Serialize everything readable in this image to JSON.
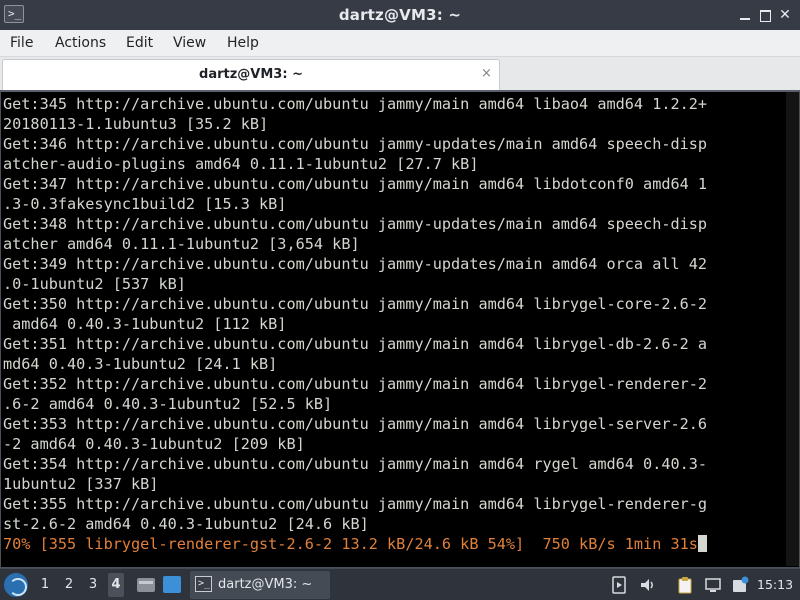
{
  "window": {
    "title": "dartz@VM3: ~",
    "icon": "terminal-icon"
  },
  "menubar": {
    "items": [
      "File",
      "Actions",
      "Edit",
      "View",
      "Help"
    ]
  },
  "tabs": [
    {
      "label": "dartz@VM3: ~",
      "close_glyph": "×"
    }
  ],
  "terminal": {
    "lines": [
      "Get:345 http://archive.ubuntu.com/ubuntu jammy/main amd64 libao4 amd64 1.2.2+",
      "20180113-1.1ubuntu3 [35.2 kB]",
      "Get:346 http://archive.ubuntu.com/ubuntu jammy-updates/main amd64 speech-disp",
      "atcher-audio-plugins amd64 0.11.1-1ubuntu2 [27.7 kB]",
      "Get:347 http://archive.ubuntu.com/ubuntu jammy/main amd64 libdotconf0 amd64 1",
      ".3-0.3fakesync1build2 [15.3 kB]",
      "Get:348 http://archive.ubuntu.com/ubuntu jammy-updates/main amd64 speech-disp",
      "atcher amd64 0.11.1-1ubuntu2 [3,654 kB]",
      "Get:349 http://archive.ubuntu.com/ubuntu jammy-updates/main amd64 orca all 42",
      ".0-1ubuntu2 [537 kB]",
      "Get:350 http://archive.ubuntu.com/ubuntu jammy/main amd64 librygel-core-2.6-2",
      " amd64 0.40.3-1ubuntu2 [112 kB]",
      "Get:351 http://archive.ubuntu.com/ubuntu jammy/main amd64 librygel-db-2.6-2 a",
      "md64 0.40.3-1ubuntu2 [24.1 kB]",
      "Get:352 http://archive.ubuntu.com/ubuntu jammy/main amd64 librygel-renderer-2",
      ".6-2 amd64 0.40.3-1ubuntu2 [52.5 kB]",
      "Get:353 http://archive.ubuntu.com/ubuntu jammy/main amd64 librygel-server-2.6",
      "-2 amd64 0.40.3-1ubuntu2 [209 kB]",
      "Get:354 http://archive.ubuntu.com/ubuntu jammy/main amd64 rygel amd64 0.40.3-",
      "1ubuntu2 [337 kB]",
      "Get:355 http://archive.ubuntu.com/ubuntu jammy/main amd64 librygel-renderer-g",
      "st-2.6-2 amd64 0.40.3-1ubuntu2 [24.6 kB]"
    ],
    "progress_line": "70% [355 librygel-renderer-gst-2.6-2 13.2 kB/24.6 kB 54%]  750 kB/s 1min 31s",
    "colors": {
      "background": "#000000",
      "foreground": "#d3d7cf",
      "progress": "#e0803a"
    }
  },
  "taskbar": {
    "workspaces": [
      "1",
      "2",
      "3",
      "4"
    ],
    "active_workspace": "4",
    "task_label": "dartz@VM3: ~",
    "clock": "15:13",
    "icons": [
      "start-menu-icon",
      "file-manager-icon",
      "app-launcher-icon",
      "terminal-icon",
      "media-icon",
      "volume-icon",
      "clipboard-icon",
      "network-icon",
      "updates-icon"
    ]
  }
}
